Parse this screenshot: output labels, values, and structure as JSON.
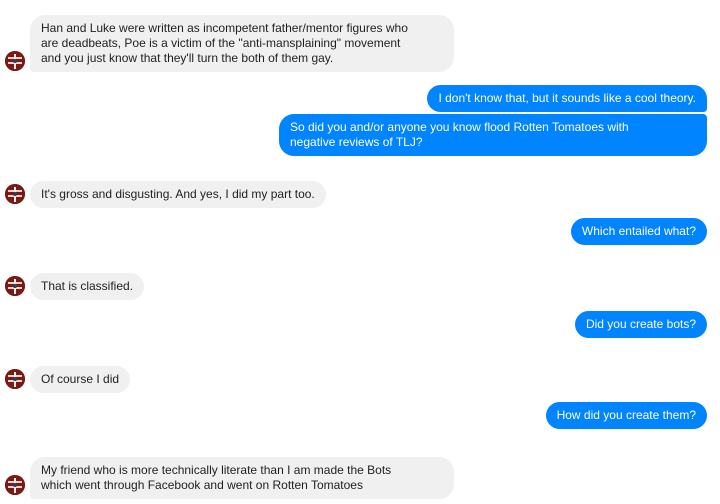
{
  "messages": [
    {
      "from": "other",
      "lines": [
        "Han and Luke were written as incompetent father/mentor figures who",
        "are deadbeats, Poe is a victim of the \"anti-mansplaining\" movement",
        "and you just know that they'll turn the both of them gay."
      ]
    },
    {
      "from": "me",
      "lines": [
        "I don't know that, but it sounds like a cool theory."
      ]
    },
    {
      "from": "me",
      "lines": [
        "So did you and/or anyone you know flood Rotten Tomatoes with",
        "negative reviews of TLJ?"
      ]
    },
    {
      "from": "other",
      "lines": [
        "It's gross and disgusting. And yes, I did my part too."
      ]
    },
    {
      "from": "me",
      "lines": [
        "Which entailed what?"
      ]
    },
    {
      "from": "other",
      "lines": [
        "That is classified."
      ]
    },
    {
      "from": "me",
      "lines": [
        "Did you create bots?"
      ]
    },
    {
      "from": "other",
      "lines": [
        "Of course I did"
      ]
    },
    {
      "from": "me",
      "lines": [
        "How did you create them?"
      ]
    },
    {
      "from": "other",
      "lines": [
        "My friend who is more technically literate than I am made the Bots",
        "which went through Facebook and went on Rotten Tomatoes"
      ]
    }
  ],
  "colors": {
    "outgoing_bubble": "#0084ff",
    "incoming_bubble": "#f1f0f0",
    "incoming_text": "#1c1e21",
    "avatar_bg": "#7a1a14"
  },
  "icons": {
    "avatar": "contact-avatar-icon"
  }
}
